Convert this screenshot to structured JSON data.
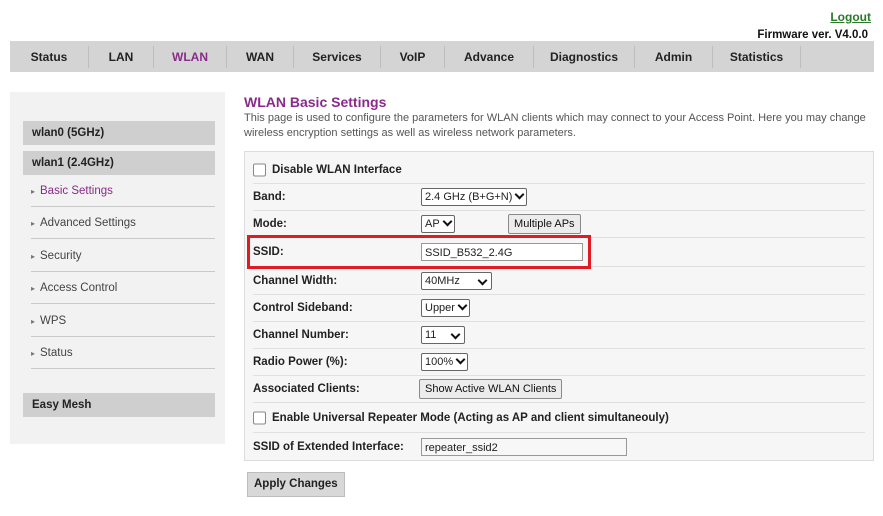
{
  "header": {
    "logout": "Logout",
    "firmware": "Firmware ver. V4.0.0"
  },
  "nav": [
    {
      "label": "Status"
    },
    {
      "label": "LAN"
    },
    {
      "label": "WLAN",
      "active": true
    },
    {
      "label": "WAN"
    },
    {
      "label": "Services"
    },
    {
      "label": "VoIP"
    },
    {
      "label": "Advance"
    },
    {
      "label": "Diagnostics"
    },
    {
      "label": "Admin"
    },
    {
      "label": "Statistics"
    }
  ],
  "sidebar": {
    "wlan0": "wlan0 (5GHz)",
    "wlan1": "wlan1 (2.4GHz)",
    "items": [
      "Basic Settings",
      "Advanced Settings",
      "Security",
      "Access Control",
      "WPS",
      "Status"
    ],
    "easy_mesh": "Easy Mesh"
  },
  "page": {
    "title": "WLAN Basic Settings",
    "description": "This page is used to configure the parameters for WLAN clients which may connect to your Access Point. Here you may change wireless encryption settings as well as wireless network parameters."
  },
  "form": {
    "disable_label": "Disable WLAN Interface",
    "band_label": "Band:",
    "band_value": "2.4 GHz (B+G+N)",
    "mode_label": "Mode:",
    "mode_value": "AP",
    "multiple_aps": "Multiple APs",
    "ssid_label": "SSID:",
    "ssid_value": "SSID_B532_2.4G",
    "channel_width_label": "Channel Width:",
    "channel_width_value": "40MHz",
    "sideband_label": "Control Sideband:",
    "sideband_value": "Upper",
    "channel_number_label": "Channel Number:",
    "channel_number_value": "11",
    "radio_power_label": "Radio Power (%):",
    "radio_power_value": "100%",
    "assoc_label": "Associated Clients:",
    "assoc_button": "Show Active WLAN Clients",
    "repeater_label": "Enable Universal Repeater Mode (Acting as AP and client simultaneouly)",
    "ext_ssid_label": "SSID of Extended Interface:",
    "ext_ssid_value": "repeater_ssid2",
    "apply": "Apply Changes"
  },
  "colors": {
    "accent": "#8a2a8a",
    "highlight": "#e01b24",
    "logout": "#2a7a2a"
  }
}
